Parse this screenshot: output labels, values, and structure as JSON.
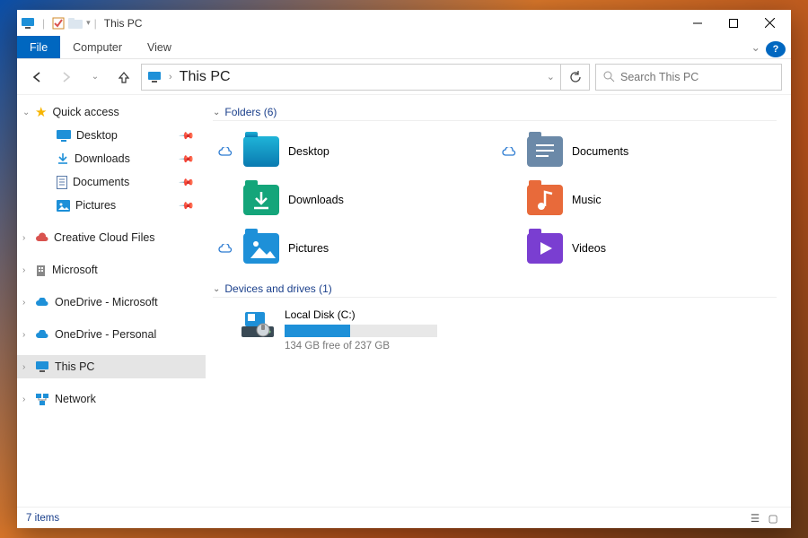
{
  "title": "This PC",
  "ribbon": {
    "file": "File",
    "computer": "Computer",
    "view": "View"
  },
  "breadcrumb": "This PC",
  "search_placeholder": "Search This PC",
  "sidebar": {
    "quick_access": "Quick access",
    "items": [
      {
        "label": "Desktop"
      },
      {
        "label": "Downloads"
      },
      {
        "label": "Documents"
      },
      {
        "label": "Pictures"
      }
    ],
    "creative": "Creative Cloud Files",
    "microsoft": "Microsoft",
    "od_ms": "OneDrive - Microsoft",
    "od_personal": "OneDrive - Personal",
    "this_pc": "This PC",
    "network": "Network"
  },
  "groups": {
    "folders_hdr": "Folders (6)",
    "drives_hdr": "Devices and drives (1)"
  },
  "folders": [
    {
      "label": "Desktop",
      "cloud": true
    },
    {
      "label": "Documents",
      "cloud": true
    },
    {
      "label": "Downloads",
      "cloud": false
    },
    {
      "label": "Music",
      "cloud": false
    },
    {
      "label": "Pictures",
      "cloud": true
    },
    {
      "label": "Videos",
      "cloud": false
    }
  ],
  "drive": {
    "label": "Local Disk (C:)",
    "sub": "134 GB free of 237 GB",
    "used_pct": 43
  },
  "status": "7 items"
}
